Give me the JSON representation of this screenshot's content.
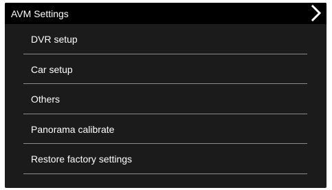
{
  "header": {
    "title": "AVM Settings",
    "next_icon": "chevron-right-icon"
  },
  "menu": {
    "items": [
      {
        "label": "DVR setup"
      },
      {
        "label": "Car setup"
      },
      {
        "label": "Others"
      },
      {
        "label": "Panorama calibrate"
      },
      {
        "label": "Restore factory settings"
      }
    ]
  },
  "colors": {
    "background": "#1b1b1b",
    "titlebar": "#000000",
    "text": "#ffffff",
    "divider": "#8c8c8c"
  }
}
